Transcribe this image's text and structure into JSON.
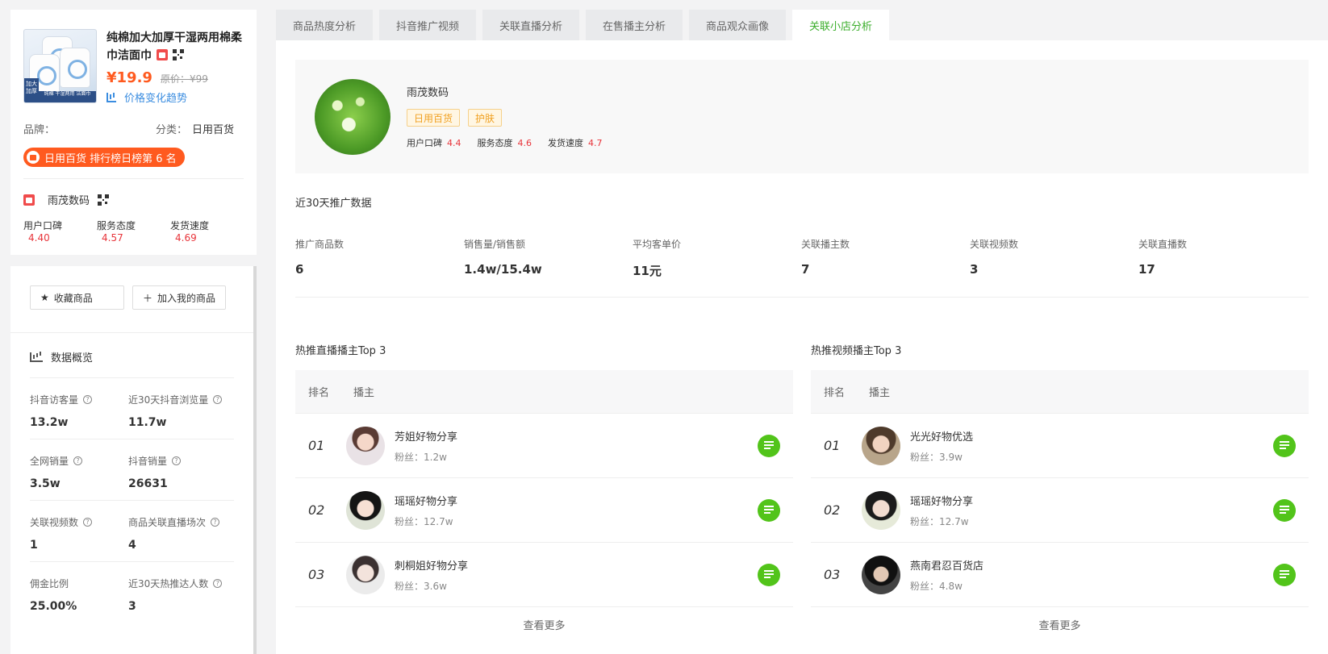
{
  "product": {
    "title": "纯棉加大加厚干湿两用棉柔巾洁面巾",
    "price": "¥19.9",
    "original_price": "原价：¥99",
    "trend_label": "价格变化趋势",
    "brand_label": "品牌：",
    "category_label": "分类：",
    "category_value": "日用百货",
    "rank_badge": "日用百货 排行榜日榜第 6 名",
    "thumb_tag": "加大加厚",
    "thumb_strip": "纯棉 干湿两用 洁面巾"
  },
  "left_shop": {
    "name": "雨茂数码",
    "scores": [
      {
        "label": "用户口碑",
        "value": "4.40"
      },
      {
        "label": "服务态度",
        "value": "4.57"
      },
      {
        "label": "发货速度",
        "value": "4.69"
      }
    ]
  },
  "actions": {
    "favorite": "收藏商品",
    "add": "加入我的商品"
  },
  "overview": {
    "title": "数据概览",
    "rows": [
      [
        {
          "label": "抖音访客量",
          "value": "13.2w"
        },
        {
          "label": "近30天抖音浏览量",
          "value": "11.7w"
        }
      ],
      [
        {
          "label": "全网销量",
          "value": "3.5w"
        },
        {
          "label": "抖音销量",
          "value": "26631"
        }
      ],
      [
        {
          "label": "关联视频数",
          "value": "1"
        },
        {
          "label": "商品关联直播场次",
          "value": "4"
        }
      ],
      [
        {
          "label": "佣金比例",
          "value": "25.00%"
        },
        {
          "label": "近30天热推达人数",
          "value": "3"
        }
      ]
    ]
  },
  "tabs": [
    "商品热度分析",
    "抖音推广视频",
    "关联直播分析",
    "在售播主分析",
    "商品观众画像",
    "关联小店分析"
  ],
  "shop": {
    "name": "雨茂数码",
    "tags": [
      "日用百货",
      "护肤"
    ],
    "scores": [
      {
        "label": "用户口碑",
        "value": "4.4"
      },
      {
        "label": "服务态度",
        "value": "4.6"
      },
      {
        "label": "发货速度",
        "value": "4.7"
      }
    ]
  },
  "promo": {
    "title": "近30天推广数据",
    "stats": [
      {
        "label": "推广商品数",
        "value": "6"
      },
      {
        "label": "销售量/销售额",
        "value": "1.4w/15.4w"
      },
      {
        "label": "平均客单价",
        "value": "11元"
      },
      {
        "label": "关联播主数",
        "value": "7"
      },
      {
        "label": "关联视频数",
        "value": "3"
      },
      {
        "label": "关联直播数",
        "value": "17"
      }
    ]
  },
  "top_live": {
    "title": "热推直播播主Top 3",
    "col_rank": "排名",
    "col_host": "播主",
    "rows": [
      {
        "rank": "01",
        "name": "芳姐好物分享",
        "fans": "粉丝：1.2w"
      },
      {
        "rank": "02",
        "name": "瑶瑶好物分享",
        "fans": "粉丝：12.7w"
      },
      {
        "rank": "03",
        "name": "刺桐姐好物分享",
        "fans": "粉丝：3.6w"
      }
    ],
    "more": "查看更多"
  },
  "top_video": {
    "title": "热推视频播主Top 3",
    "col_rank": "排名",
    "col_host": "播主",
    "rows": [
      {
        "rank": "01",
        "name": "光光好物优选",
        "fans": "粉丝：3.9w"
      },
      {
        "rank": "02",
        "name": "瑶瑶好物分享",
        "fans": "粉丝：12.7w"
      },
      {
        "rank": "03",
        "name": "燕南君忍百货店",
        "fans": "粉丝：4.8w"
      }
    ],
    "more": "查看更多"
  }
}
